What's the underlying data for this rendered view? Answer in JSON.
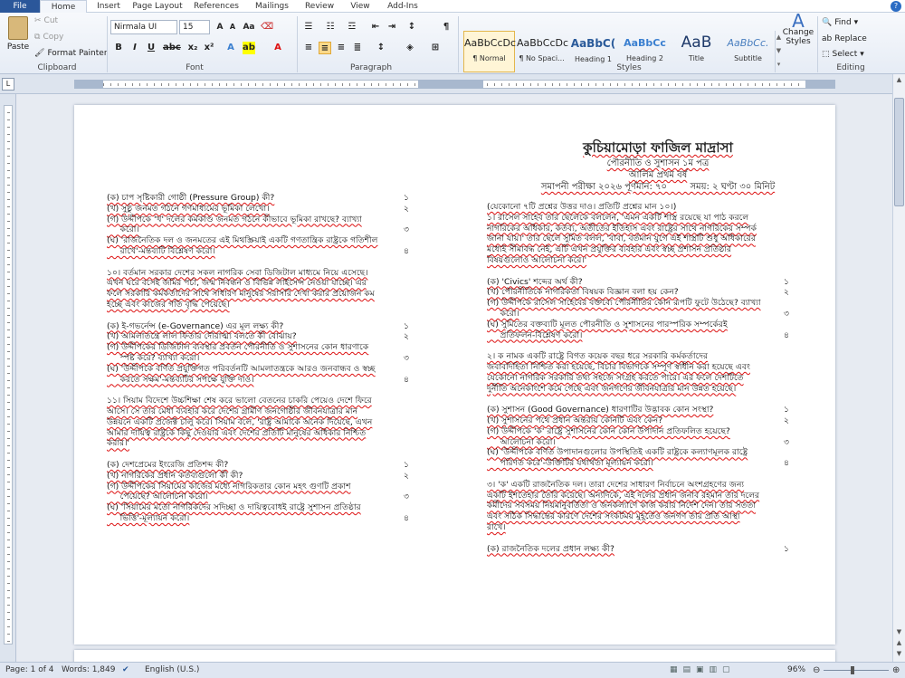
{
  "tabs": [
    "File",
    "Home",
    "Insert",
    "Page Layout",
    "References",
    "Mailings",
    "Review",
    "View",
    "Add-Ins"
  ],
  "clipboard": {
    "paste": "Paste",
    "cut": "Cut",
    "copy": "Copy",
    "format_painter": "Format Painter",
    "label": "Clipboard"
  },
  "font": {
    "name": "Nirmala UI",
    "size": "15",
    "label": "Font"
  },
  "paragraph": {
    "label": "Paragraph"
  },
  "styles": {
    "label": "Styles",
    "items": [
      {
        "preview": "AaBbCcDc",
        "name": "¶ Normal"
      },
      {
        "preview": "AaBbCcDc",
        "name": "¶ No Spaci..."
      },
      {
        "preview": "AaBbC(",
        "name": "Heading 1"
      },
      {
        "preview": "AaBbCc",
        "name": "Heading 2"
      },
      {
        "preview": "AaB",
        "name": "Title"
      },
      {
        "preview": "AaBbCc.",
        "name": "Subtitle"
      }
    ],
    "change": "Change Styles"
  },
  "editing": {
    "find": "Find",
    "replace": "Replace",
    "select": "Select",
    "label": "Editing"
  },
  "status": {
    "page": "Page: 1 of 4",
    "words": "Words: 1,849",
    "lang": "English (U.S.)",
    "zoom": "96%"
  },
  "doc": {
    "title": "কুচিয়ামোড়া ফাজিল মাদ্রাসা",
    "sub1": "পৌরনীতি ও সুশাসন ১ম পত্র",
    "sub2": "আলিম প্রথম বর্ষ",
    "sub3": "সমাপনী পরীক্ষা ২০২৬ পূর্ণমান: ৭০        সময়: ২ ঘণ্টা ৩০ মিনিট",
    "left": [
      {
        "t": "(ক) চাপ সৃষ্টিকারী গোষ্ঠী (Pressure Group) কী?",
        "n": "১"
      },
      {
        "t": "(খ) সুষ্ঠু জনমত গঠনে গণমাধ্যমের ভূমিকা লেখো।",
        "n": "২"
      },
      {
        "t": "(গ) উদ্দীপকে 'খ' দলের কর্মকাণ্ড জনমত গঠনে কীভাবে ভূমিকা রাখছে? ব্যাখ্যা",
        "n": ""
      },
      {
        "t": "     করো।",
        "n": "৩"
      },
      {
        "t": "(ঘ) 'রাজনৈতিক দল ও জনমতের এই মিথস্ক্রিয়াই একটি গণতান্ত্রিক রাষ্ট্রকে গতিশীল",
        "n": ""
      },
      {
        "t": "     রাখে'-মন্তব্যটি বিশ্লেষণ করো।",
        "n": "৪"
      },
      {
        "t": "",
        "n": ""
      },
      {
        "t": "১০। বর্তমান সরকার দেশের সকল নাগরিক সেবা ডিজিটাল মাধ্যমে নিয়ে এসেছে।",
        "n": ""
      },
      {
        "t": "এখন ঘরে বসেই জমির পর্চা, জন্ম নিবন্ধন ও বিভিন্ন লাইসেন্স নেওয়া যাচ্ছে। এর",
        "n": ""
      },
      {
        "t": "ফলে সরকারি কর্মকর্তাদের সাথে সাধারণ মানুষের সরাসরি দেখা করার প্রয়োজন কম",
        "n": ""
      },
      {
        "t": "হচ্ছে এবং কাজের গতি বৃদ্ধি পেয়েছে।",
        "n": ""
      },
      {
        "t": "",
        "n": ""
      },
      {
        "t": "(ক) ই-গভর্নেন্স (e-Governance) এর মূল লক্ষ্য কী?",
        "n": "১"
      },
      {
        "t": "(খ) আমলাতন্ত্রে লাল ফিতার দৌরাত্ম্য বলতে কী বোঝায়?",
        "n": "২"
      },
      {
        "t": "(গ) উদ্দীপকের ডিজিটাল ব্যবস্থার প্রবর্তন পৌরনীতি ও সুশাসনের কোন ধারণাকে",
        "n": ""
      },
      {
        "t": "     স্পষ্ট করে? ব্যাখ্যা করো।",
        "n": "৩"
      },
      {
        "t": "(ঘ) 'উদ্দীপকে বর্ণিত প্রযুক্তিগত পরিবর্তনটি আমলাতন্ত্রকে আরও জনবান্ধব ও স্বচ্ছ",
        "n": ""
      },
      {
        "t": "     করতে সক্ষম'-মন্তব্যটির সপক্ষে যুক্তি দাও।",
        "n": "৪"
      },
      {
        "t": "",
        "n": ""
      },
      {
        "t": "১১। সিয়াম বিদেশে উচ্চশিক্ষা শেষ করে ভালো বেতনের চাকরি পেয়েও দেশে ফিরে",
        "n": ""
      },
      {
        "t": "আসে। সে তার মেধা ব্যবহার করে দেশের গ্রামীণ জনগোষ্ঠীর জীবনযাত্রার মান",
        "n": ""
      },
      {
        "t": "উন্নয়নে একটি প্রজেক্ট চালু করে। সিয়াম বলে, 'রাষ্ট্র আমাকে অনেক দিয়েছে, এখন",
        "n": ""
      },
      {
        "t": "আমার দায়িত্ব রাষ্ট্রকে কিছু দেওয়ার এবং দেশের প্রতিটি মানুষের অধিকার নিশ্চিত",
        "n": ""
      },
      {
        "t": "করার।'",
        "n": ""
      },
      {
        "t": "",
        "n": ""
      },
      {
        "t": "(ক) দেশপ্রেমের ইংরেজি প্রতিশব্দ কী?",
        "n": "১"
      },
      {
        "t": "(খ) নাগরিকের প্রধান কর্তব্যগুলো কী কী?",
        "n": "২"
      },
      {
        "t": "(গ) উদ্দীপকের সিয়ামের কাজের মধ্যে নাগরিকতার কোন মহৎ গুণটি প্রকাশ",
        "n": ""
      },
      {
        "t": "     পেয়েছে? আলোচনা করো।",
        "n": "৩"
      },
      {
        "t": "(ঘ) 'সিয়ামের মতো নাগরিকদের সদিচ্ছা ও দায়িত্ববোধই রাষ্ট্রে সুশাসন প্রতিষ্ঠার",
        "n": ""
      },
      {
        "t": "     ভিত্তি'-মূল্যায়ন করো।",
        "n": "৪"
      }
    ],
    "right": [
      {
        "t": "(যেকোনো ৭টি প্রশ্নের উত্তর দাও। প্রতিটি প্রশ্নের মান ১০।)",
        "n": ""
      },
      {
        "t": "১। রাসেল সাহেব তার ছেলেকে বললেন, 'এমন একটি শাস্ত্র রয়েছে যা পাঠ করলে",
        "n": ""
      },
      {
        "t": "নাগরিকের অধিকার, কর্তব্য, অতীতের ইতিহাস এবং রাষ্ট্রের সাথে নাগরিকের সম্পর্ক",
        "n": ""
      },
      {
        "t": "জানা যায়।' তার ছেলে সুমিত বলল, 'বাবা, বর্তমান যুগে এই শাস্ত্রটি শুধু অধিকারের",
        "n": ""
      },
      {
        "t": "মধ্যেই সীমাবদ্ধ নেই, এটি এখন প্রযুক্তির ব্যবহার এবং স্বচ্ছ প্রশাসন প্রতিষ্ঠার",
        "n": ""
      },
      {
        "t": "বিষয়গুলোও আলোচনা করে।'",
        "n": ""
      },
      {
        "t": "",
        "n": ""
      },
      {
        "t": "(ক) 'Civics' শব্দের অর্থ কী?",
        "n": "১"
      },
      {
        "t": "(খ) পৌরনীতিকে নাগরিকতা বিষয়ক বিজ্ঞান বলা হয় কেন?",
        "n": "২"
      },
      {
        "t": "(গ) উদ্দীপকে রাসেল সাহেবের বক্তব্যে পৌরনীতির কোন রূপটি ফুটে উঠেছে? ব্যাখ্যা",
        "n": ""
      },
      {
        "t": "     করো।",
        "n": "৩"
      },
      {
        "t": "(ঘ) সুমিতের বক্তব্যটি মূলত পৌরনীতি ও সুশাসনের পারস্পরিক সম্পর্কেরই",
        "n": ""
      },
      {
        "t": "     প্রতিফলন-বিশ্লেষণ করো।",
        "n": "৪"
      },
      {
        "t": "",
        "n": ""
      },
      {
        "t": "২। ক নামক একটি রাষ্ট্রে বিগত কয়েক বছর ধরে সরকারি কর্মকর্তাদের",
        "n": ""
      },
      {
        "t": "জবাবদিহিতা নিশ্চিত করা হয়েছে, বিচার বিভাগকে সম্পূর্ণ স্বাধীন করা হয়েছে এবং",
        "n": ""
      },
      {
        "t": "যেকোনো নাগরিক সরকারি তথ্য সহজে সংগ্রহ করতে পারে। এর ফলে দেশটিতে",
        "n": ""
      },
      {
        "t": "দুর্নীতি অনেকাংশে কমে গেছে এবং জনগণের জীবনযাত্রার মান উন্নত হয়েছে।",
        "n": ""
      },
      {
        "t": "",
        "n": ""
      },
      {
        "t": "(ক) সুশাসন (Good Governance) ধারণাটির উদ্ভাবক কোন সংস্থা?",
        "n": "১"
      },
      {
        "t": "(খ) সুশাসনের পথে প্রধান অন্তরায় কোনটি এবং কেন?",
        "n": "২"
      },
      {
        "t": "(গ) উদ্দীপকে 'ক' রাষ্ট্রে সুশাসনের কোন কোন উপাদান প্রতিফলিত হয়েছে?",
        "n": ""
      },
      {
        "t": "     আলোচনা করো।",
        "n": "৩"
      },
      {
        "t": "(ঘ) 'উদ্দীপকে বর্ণিত উপাদানগুলোর উপস্থিতিই একটি রাষ্ট্রকে কল্যাণমূলক রাষ্ট্রে",
        "n": ""
      },
      {
        "t": "     পরিণত করে'-উক্তিটির যথার্থতা মূল্যায়ন করো।",
        "n": "৪"
      },
      {
        "t": "",
        "n": ""
      },
      {
        "t": "৩। 'ক' একটি রাজনৈতিক দল। তারা দেশের সাধারণ নির্বাচনে অংশগ্রহণের জন্য",
        "n": ""
      },
      {
        "t": "একটি ইশতেহার তৈরি করেছে। অন্যদিকে, এই দলের প্রধান জনাব রহমান তার দলের",
        "n": ""
      },
      {
        "t": "কর্মীদের সবসময় নিয়মানুবর্তিতা ও জনকল্যাণে কাজ করার নির্দেশ দেন। তার সততা",
        "n": ""
      },
      {
        "t": "এবং সঠিক সিদ্ধান্তের কারণে দেশের সংকটময় মুহূর্তেও জনগণ তার প্রতি আস্থা",
        "n": ""
      },
      {
        "t": "রাখে।",
        "n": ""
      },
      {
        "t": "",
        "n": ""
      },
      {
        "t": "(ক) রাজনৈতিক দলের প্রধান লক্ষ্য কী?",
        "n": "১"
      }
    ]
  }
}
